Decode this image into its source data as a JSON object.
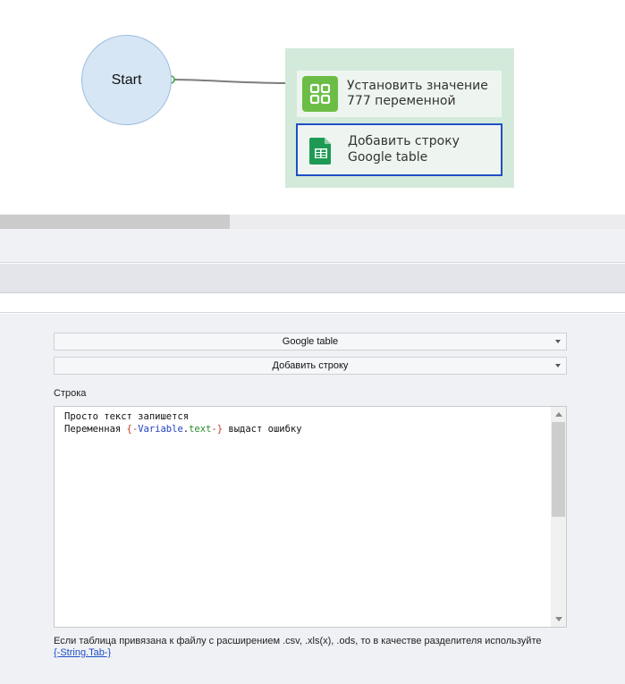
{
  "canvas": {
    "start_label": "Start",
    "actions": [
      {
        "line1": "Установить значение",
        "line2": "777 переменной",
        "icon": "grid-icon"
      },
      {
        "line1": "Добавить строку",
        "line2": "Google table",
        "icon": "google-sheets-icon"
      }
    ]
  },
  "properties": {
    "service_select": "Google table",
    "action_select": "Добавить строку",
    "row_label": "Строка",
    "text_line1": "Просто текст запишется",
    "text_line2_prefix": "Переменная ",
    "text_line2_brace_open": "{-",
    "text_line2_var": "Variable",
    "text_line2_dot": ".",
    "text_line2_field": "text",
    "text_line2_brace_close": "-}",
    "text_line2_suffix": " выдаст ошибку",
    "hint_text": "Если таблица привязана к файлу с расширением .csv, .xls(x), .ods, то в качестве разделителя используйте",
    "hint_link": "{-String.Tab-}"
  },
  "colors": {
    "selected_border": "#1f4fc6",
    "action_icon_green": "#6bbd45",
    "group_bg": "#d3eadb",
    "start_node_bg": "#d6e6f5"
  }
}
